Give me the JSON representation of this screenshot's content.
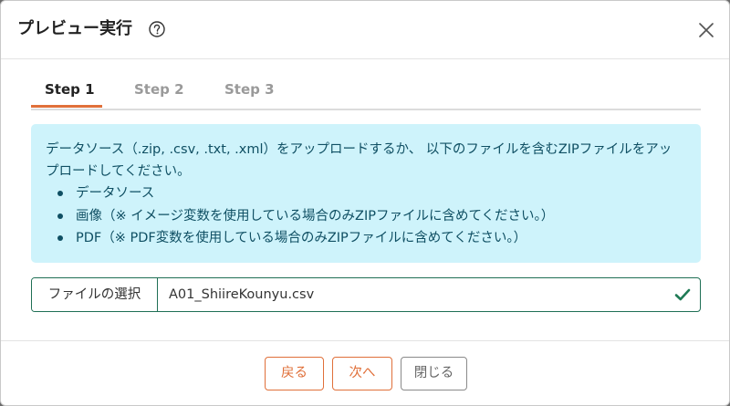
{
  "header": {
    "title": "プレビュー実行"
  },
  "tabs": [
    {
      "label": "Step 1",
      "active": true
    },
    {
      "label": "Step 2",
      "active": false
    },
    {
      "label": "Step 3",
      "active": false
    }
  ],
  "info": {
    "text": "データソース（.zip, .csv, .txt, .xml）をアップロードするか、 以下のファイルを含むZIPファイルをアップロードしてください。",
    "items": [
      "データソース",
      "画像（※ イメージ変数を使用している場合のみZIPファイルに含めてください。）",
      "PDF（※ PDF変数を使用している場合のみZIPファイルに含めてください。）"
    ]
  },
  "file": {
    "button_label": "ファイルの選択",
    "selected_name": "A01_ShiireKounyu.csv"
  },
  "footer": {
    "back_label": "戻る",
    "next_label": "次へ",
    "close_label": "閉じる"
  },
  "colors": {
    "accent": "#e0703a",
    "info_bg": "#cef3fb",
    "info_text": "#0f4f63",
    "success": "#1f7a55"
  }
}
